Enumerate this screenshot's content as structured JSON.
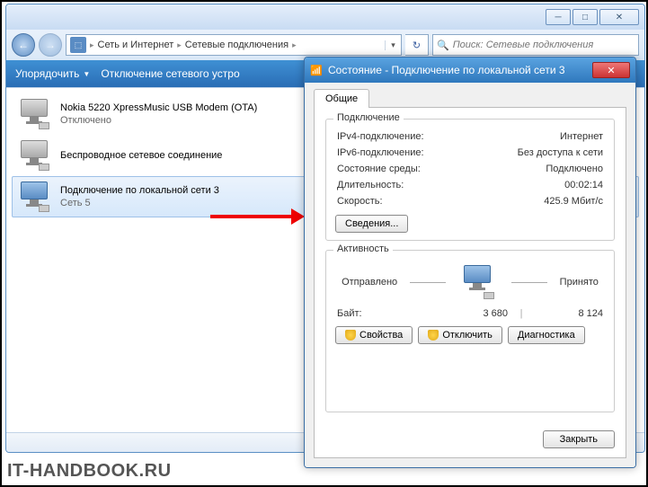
{
  "explorer": {
    "breadcrumb": [
      "Сеть и Интернет",
      "Сетевые подключения"
    ],
    "search_placeholder": "Поиск: Сетевые подключения",
    "toolbar": {
      "organize": "Упорядочить",
      "disable": "Отключение сетевого устро"
    },
    "items": [
      {
        "name": "Nokia 5220 XpressMusic USB Modem (OTA)",
        "status": "Отключено",
        "on": false
      },
      {
        "name": "Беспроводное сетевое соединение",
        "status": "",
        "on": false
      },
      {
        "name": "Подключение по локальной сети 3",
        "status": "Сеть 5",
        "on": true
      }
    ]
  },
  "dialog": {
    "title": "Состояние - Подключение по локальной сети 3",
    "tab": "Общие",
    "group_conn": "Подключение",
    "rows": {
      "ipv4_l": "IPv4-подключение:",
      "ipv4_v": "Интернет",
      "ipv6_l": "IPv6-подключение:",
      "ipv6_v": "Без доступа к сети",
      "media_l": "Состояние среды:",
      "media_v": "Подключено",
      "dur_l": "Длительность:",
      "dur_v": "00:02:14",
      "speed_l": "Скорость:",
      "speed_v": "425.9 Мбит/с"
    },
    "details_btn": "Сведения...",
    "group_act": "Активность",
    "sent": "Отправлено",
    "recv": "Принято",
    "bytes_l": "Байт:",
    "bytes_sent": "3 680",
    "bytes_recv": "8 124",
    "btn_props": "Свойства",
    "btn_disable": "Отключить",
    "btn_diag": "Диагностика",
    "btn_close": "Закрыть"
  },
  "watermark": "IT-HANDBOOK.RU"
}
